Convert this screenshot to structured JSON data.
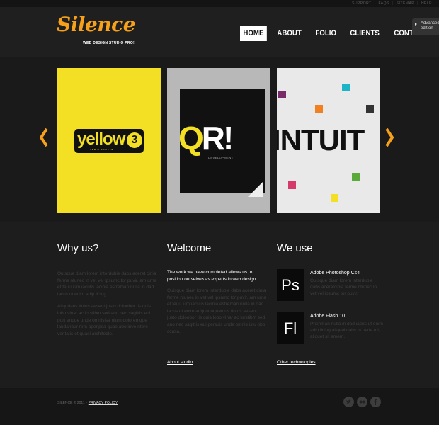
{
  "top_links": [
    "SUPPORT",
    "FAQS",
    "SITEMAP",
    "HELP"
  ],
  "logo": {
    "text": "Silence",
    "tagline": "WEB DESIGN STUDIO PRO!"
  },
  "nav": [
    {
      "label": "HOME",
      "active": true
    },
    {
      "label": "ABOUT",
      "active": false
    },
    {
      "label": "FOLIO",
      "active": false
    },
    {
      "label": "CLIENTS",
      "active": false
    },
    {
      "label": "CONTACTS",
      "active": false
    }
  ],
  "advanced": {
    "line1": "Advanced",
    "line2": "edition"
  },
  "slides": {
    "yellow": {
      "text": "yellow",
      "badge": "3",
      "sub": "SEE A SAMPLE"
    },
    "qr": {
      "text_q": "Q",
      "text_r": "R!",
      "sub": "DEVELOPMENT"
    },
    "intuit": {
      "text": "INTUIT"
    }
  },
  "columns": {
    "why": {
      "title": "Why us?",
      "p1": "Quisque diam lorem interdubie dabs aceret cinia ferme ntunec in vet vel ipsumc tor puvir. am urna et feuu ium iaculis lacinia estreman nulla in dad iacus ut enim adip licing.",
      "p2": "Aliqudaus tintus aesent justo doloobor tis quis lobo vinar ac lorstibm sed ano nec sagittis eui port enque unde omnisisa nium doloremque laudanbur rem aperipsa quae abo inve ntore veritatis et quasi architecte."
    },
    "welcome": {
      "title": "Welcome",
      "lead": "The work we have completed allows us to position ourselves as experts in web design",
      "p1": "Quisque diam lorem interdubie dabs aceret cinia ferme ntunec in vet vel ipsumc tor puvir. am urna et feuu ium iaculis lacinia estreman nulla in dad iacus ut enim adip nonquatuus tintus aesent justo doloobor tis quis lobo vinar ac lorstibm sed ano nec sagittis eui persuis unde omnis istu obb ccusa.",
      "link": "About studio"
    },
    "we_use": {
      "title": "We use",
      "items": [
        {
          "icon": "Ps",
          "title": "Adobe Photoshop Cs4",
          "desc": "Quisque diam lorem interdubie dabs aceratcinia ferme ntunec in vet vel ipsumc tor puvir."
        },
        {
          "icon": "Fl",
          "title": "Adobe Flash 10",
          "desc": "Proinman nulla in dad iacus ut enim adip licing aliqeulinabs in pede mi, aliquet sit amem."
        }
      ],
      "link": "Other technologies"
    }
  },
  "footer": {
    "copyright": "SILENCE © 2011 •",
    "privacy": "PRIVACY POLICY"
  },
  "social": [
    "twitter",
    "flickr",
    "facebook"
  ],
  "colors": {
    "accent": "#f7a11b",
    "slide_yellow": "#f3e024",
    "bg": "#1c1c1c"
  }
}
